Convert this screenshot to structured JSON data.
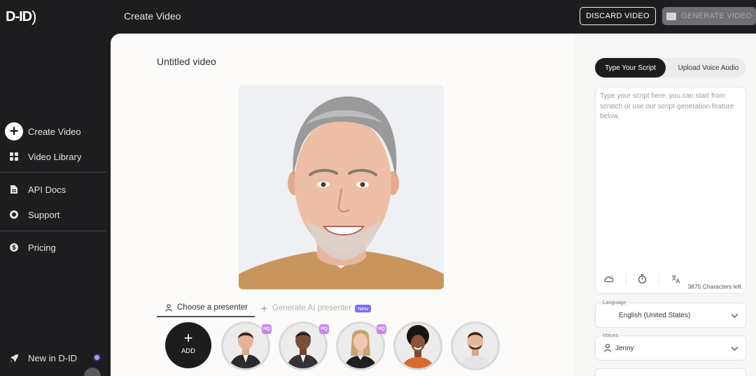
{
  "app": {
    "logo": "D-ID",
    "page_title": "Create Video"
  },
  "toolbar": {
    "discard_label": "DISCARD VIDEO",
    "generate_label": "GENERATE VIDEO"
  },
  "sidebar": {
    "items": [
      {
        "label": "Create Video",
        "icon": "plus-circle-icon"
      },
      {
        "label": "Video Library",
        "icon": "grid-icon"
      },
      {
        "label": "API Docs",
        "icon": "document-icon"
      },
      {
        "label": "Support",
        "icon": "lifebuoy-icon"
      },
      {
        "label": "Pricing",
        "icon": "dollar-icon"
      }
    ],
    "footer_item": {
      "label": "New in D-ID",
      "icon": "rocket-icon"
    }
  },
  "main": {
    "video_title": "Untitled video",
    "tabs": [
      {
        "label": "Choose a presenter",
        "icon": "person-icon",
        "active": true
      },
      {
        "label": "Generate AI presenter",
        "icon": "sparkle-icon",
        "badge": "New",
        "active": false
      }
    ],
    "add_label": "ADD",
    "presenters": [
      {
        "badge": "HQ"
      },
      {
        "badge": "HQ"
      },
      {
        "badge": "HQ"
      },
      {
        "badge": ""
      },
      {
        "badge": ""
      }
    ]
  },
  "script": {
    "tabs": [
      "Type Your Script",
      "Upload Voice Audio"
    ],
    "placeholder": "Type your script here, you can start from scratch or use our script-generation feature below.",
    "chars_left": "3875 Characters left"
  },
  "language": {
    "label": "Language",
    "value": "English (United States)"
  },
  "voice": {
    "label": "Voices",
    "value": "Jenny"
  },
  "colors": {
    "dark": "#1d1d1f",
    "accent": "#7b6cf6",
    "hq_badge": "#c785f0"
  }
}
